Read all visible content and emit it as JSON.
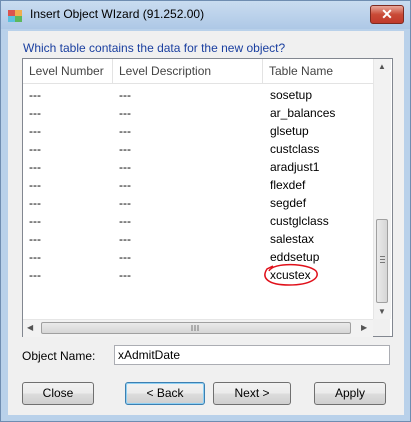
{
  "window": {
    "title": "Insert Object WIzard (91.252.00)",
    "close_glyph": "✕"
  },
  "prompt": "Which table contains the data for the new object?",
  "table": {
    "columns": [
      "Level Number",
      "Level Description",
      "Table Name"
    ],
    "rows": [
      [
        "---",
        "---",
        "sosetup"
      ],
      [
        "---",
        "---",
        "ar_balances"
      ],
      [
        "---",
        "---",
        "glsetup"
      ],
      [
        "---",
        "---",
        "custclass"
      ],
      [
        "---",
        "---",
        "aradjust1"
      ],
      [
        "---",
        "---",
        "flexdef"
      ],
      [
        "---",
        "---",
        "segdef"
      ],
      [
        "---",
        "---",
        "custglclass"
      ],
      [
        "---",
        "---",
        "salestax"
      ],
      [
        "---",
        "---",
        "eddsetup"
      ],
      [
        "---",
        "---",
        "xcustex"
      ]
    ],
    "highlighted_row": 10,
    "annotation_color": "#e0101a"
  },
  "object_name": {
    "label": "Object Name:",
    "value": "xAdmitDate"
  },
  "buttons": {
    "close": "Close",
    "back": "< Back",
    "next": "Next >",
    "apply": "Apply"
  },
  "colors": {
    "prompt": "#1a3fa0",
    "title_bar": "#b9d1ea",
    "close_button": "#c94a36"
  }
}
